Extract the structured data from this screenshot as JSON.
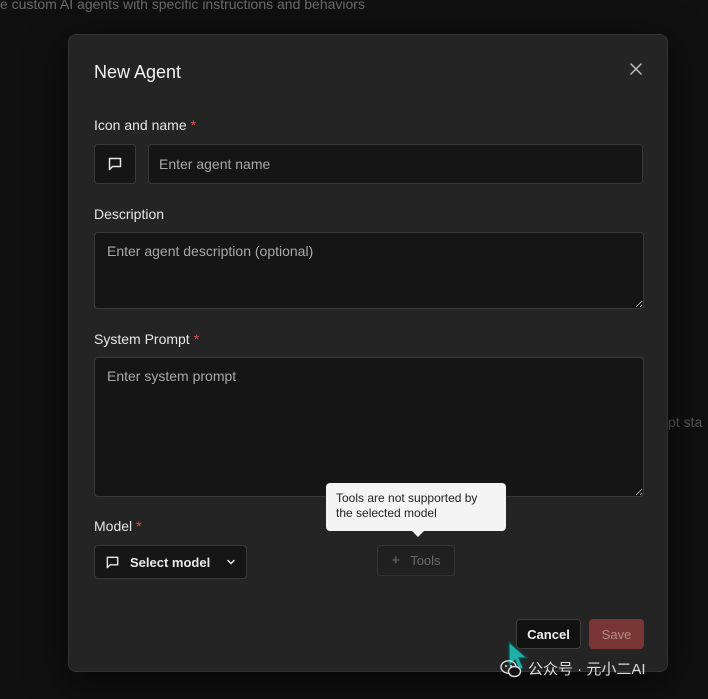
{
  "background": {
    "top_text": "e custom AI agents with specific instructions and behaviors",
    "side_text": "pt sta"
  },
  "dialog": {
    "title": "New Agent",
    "close_icon": "close-icon",
    "icon_name_label": "Icon and name",
    "required_mark": "*",
    "agent_icon": "message-square-icon",
    "name_placeholder": "Enter agent name",
    "description_label": "Description",
    "description_placeholder": "Enter agent description (optional)",
    "system_prompt_label": "System Prompt",
    "system_prompt_placeholder": "Enter system prompt",
    "model_label": "Model",
    "model_select_label": "Select model",
    "model_icon": "message-square-icon",
    "chevron_icon": "chevron-down-icon",
    "tools_label": "Tools",
    "tools_icon": "plus-icon",
    "tooltip_text": "Tools are not supported by the selected model",
    "cancel_label": "Cancel",
    "save_label": "Save"
  },
  "watermark": {
    "text": "公众号 · 元小二AI"
  },
  "colors": {
    "accent_required": "#d8534e",
    "save_disabled": "#7a3634",
    "surface": "#242424",
    "input_bg": "#151515"
  }
}
